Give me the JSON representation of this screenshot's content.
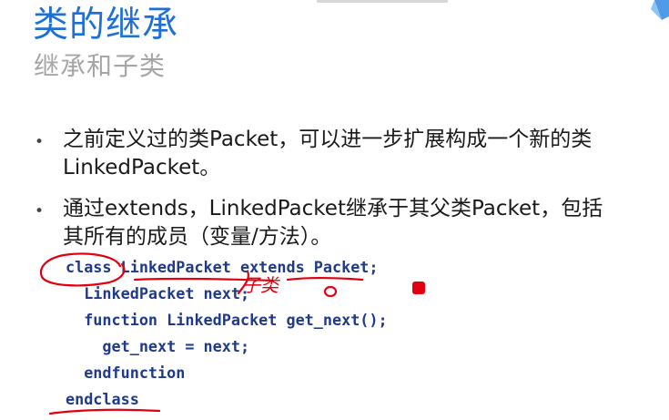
{
  "slide": {
    "title": "类的继承",
    "subtitle": "继承和子类"
  },
  "bullets": [
    {
      "line1": "之前定义过的类Packet，可以进一步扩展构成一个新的类",
      "line2": "LinkedPacket。"
    },
    {
      "line1": "通过extends，LinkedPacket继承于其父类Packet，包括",
      "line2": "其所有的成员（变量/方法）。"
    }
  ],
  "code": [
    "class LinkedPacket extends Packet;",
    "  LinkedPacket next;",
    "  function LinkedPacket get_next();",
    "    get_next = next;",
    "  endfunction",
    "endclass"
  ],
  "annotations": {
    "handwriting": "子类",
    "pen_color": "#e20010",
    "pointer_color": "#e20010"
  },
  "colors": {
    "title": "#1e6fd6",
    "subtitle": "#a6a6a6",
    "code": "#1f3a8a"
  },
  "icons": [
    "corner-logo-icon",
    "bullet-dot-icon"
  ]
}
